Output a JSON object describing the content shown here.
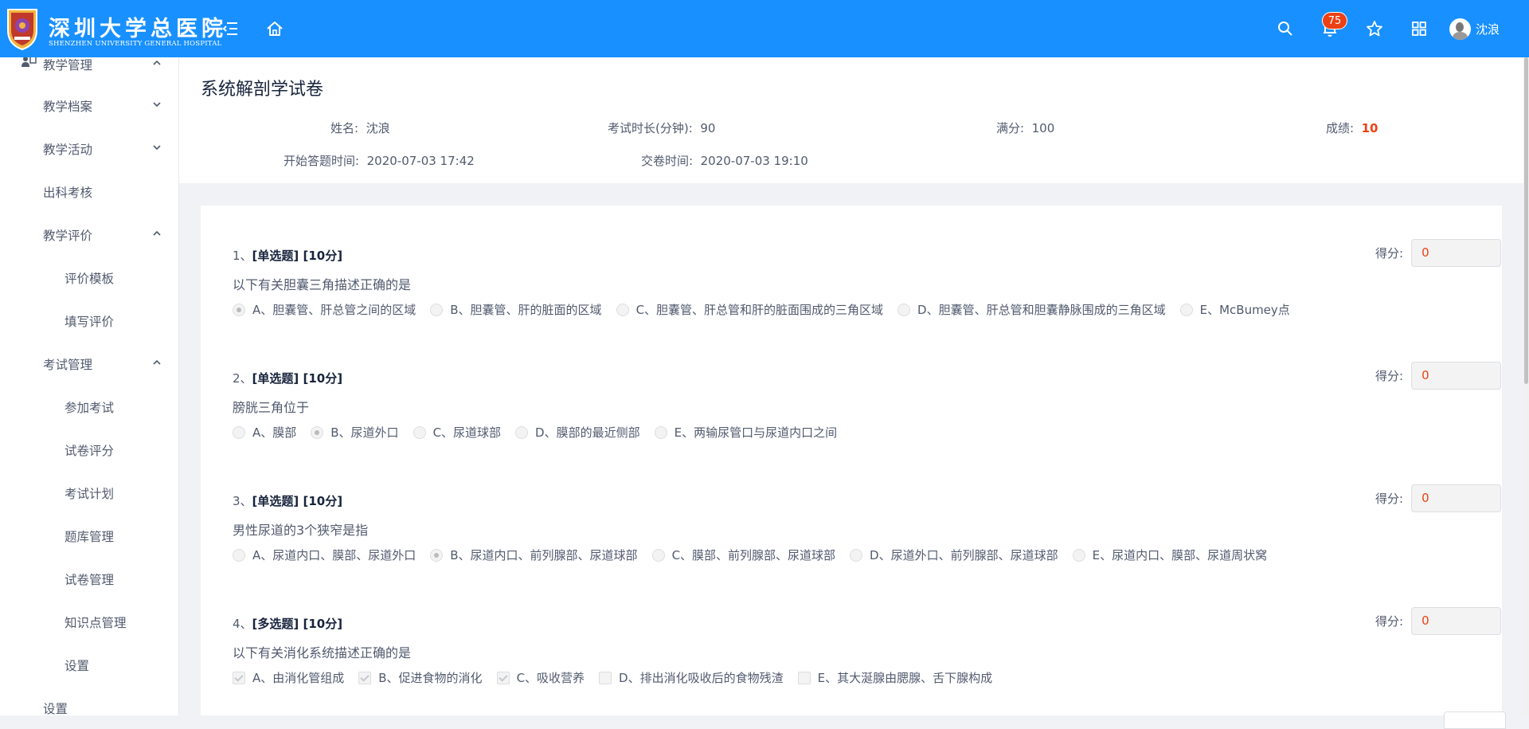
{
  "header": {
    "logo_cn": "深圳大学总医院",
    "logo_en": "SHENZHEN UNIVERSITY GENERAL HOSPITAL",
    "notification_count": "75",
    "user_name": "沈浪",
    "accent_color": "#1890ff"
  },
  "sidebar": {
    "items": [
      {
        "label": "教学管理",
        "level": 1,
        "arrow": "up",
        "icon": "teaching-icon"
      },
      {
        "label": "教学档案",
        "level": 1,
        "arrow": "down"
      },
      {
        "label": "教学活动",
        "level": 1,
        "arrow": "down"
      },
      {
        "label": "出科考核",
        "level": 1,
        "arrow": ""
      },
      {
        "label": "教学评价",
        "level": 1,
        "arrow": "up"
      },
      {
        "label": "评价模板",
        "level": 2,
        "arrow": ""
      },
      {
        "label": "填写评价",
        "level": 2,
        "arrow": ""
      },
      {
        "label": "考试管理",
        "level": 1,
        "arrow": "up"
      },
      {
        "label": "参加考试",
        "level": 2,
        "arrow": ""
      },
      {
        "label": "试卷评分",
        "level": 2,
        "arrow": ""
      },
      {
        "label": "考试计划",
        "level": 2,
        "arrow": ""
      },
      {
        "label": "题库管理",
        "level": 2,
        "arrow": ""
      },
      {
        "label": "试卷管理",
        "level": 2,
        "arrow": ""
      },
      {
        "label": "知识点管理",
        "level": 2,
        "arrow": ""
      },
      {
        "label": "设置",
        "level": 2,
        "arrow": ""
      },
      {
        "label": "设置",
        "level": 1,
        "arrow": ""
      }
    ]
  },
  "exam": {
    "title": "系统解剖学试卷",
    "name_label": "姓名:",
    "name_value": "沈浪",
    "duration_label": "考试时长(分钟):",
    "duration_value": "90",
    "full_label": "满分:",
    "full_value": "100",
    "score_label": "成绩:",
    "score_value": "10",
    "start_label": "开始答题时间:",
    "start_value": "2020-07-03 17:42",
    "submit_label": "交卷时间:",
    "submit_value": "2020-07-03 19:10"
  },
  "score_label": "得分:",
  "questions": [
    {
      "num": "1、",
      "type": "[单选题] [10分]",
      "text": "以下有关胆囊三角描述正确的是",
      "kind": "radio",
      "score": "0",
      "options": [
        {
          "label": "A、胆囊管、肝总管之间的区域",
          "checked": true
        },
        {
          "label": "B、胆囊管、肝的脏面的区域",
          "checked": false
        },
        {
          "label": "C、胆囊管、肝总管和肝的脏面围成的三角区域",
          "checked": false
        },
        {
          "label": "D、胆囊管、肝总管和胆囊静脉围成的三角区域",
          "checked": false
        },
        {
          "label": "E、McBumey点",
          "checked": false
        }
      ]
    },
    {
      "num": "2、",
      "type": "[单选题] [10分]",
      "text": "膀胱三角位于",
      "kind": "radio",
      "score": "0",
      "options": [
        {
          "label": "A、膜部",
          "checked": false
        },
        {
          "label": "B、尿道外口",
          "checked": true
        },
        {
          "label": "C、尿道球部",
          "checked": false
        },
        {
          "label": "D、膜部的最近侧部",
          "checked": false
        },
        {
          "label": "E、两输尿管口与尿道内口之间",
          "checked": false
        }
      ]
    },
    {
      "num": "3、",
      "type": "[单选题] [10分]",
      "text": "男性尿道的3个狭窄是指",
      "kind": "radio",
      "score": "0",
      "options": [
        {
          "label": "A、尿道内口、膜部、尿道外口",
          "checked": false
        },
        {
          "label": "B、尿道内口、前列腺部、尿道球部",
          "checked": true
        },
        {
          "label": "C、膜部、前列腺部、尿道球部",
          "checked": false
        },
        {
          "label": "D、尿道外口、前列腺部、尿道球部",
          "checked": false
        },
        {
          "label": "E、尿道内口、膜部、尿道周状窝",
          "checked": false
        }
      ]
    },
    {
      "num": "4、",
      "type": "[多选题] [10分]",
      "text": "以下有关消化系统描述正确的是",
      "kind": "checkbox",
      "score": "0",
      "options": [
        {
          "label": "A、由消化管组成",
          "checked": true
        },
        {
          "label": "B、促进食物的消化",
          "checked": true
        },
        {
          "label": "C、吸收营养",
          "checked": true
        },
        {
          "label": "D、排出消化吸收后的食物残渣",
          "checked": false
        },
        {
          "label": "E、其大涎腺由腮腺、舌下腺构成",
          "checked": false
        }
      ]
    }
  ]
}
